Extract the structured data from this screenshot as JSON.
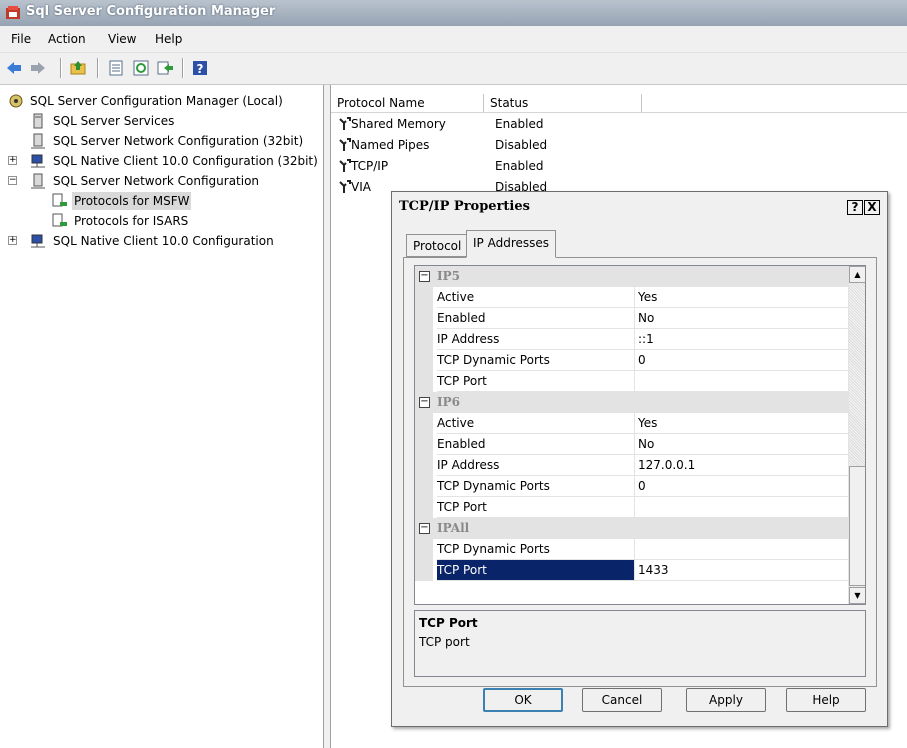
{
  "window": {
    "title": "Sql Server Configuration Manager"
  },
  "menu": [
    "File",
    "Action",
    "View",
    "Help"
  ],
  "toolbar": {
    "icons": [
      "back-arrow-icon",
      "forward-arrow-icon",
      "up-folder-icon",
      "properties-icon",
      "refresh-icon",
      "export-icon",
      "help-icon"
    ]
  },
  "tree": {
    "root": "SQL Server Configuration Manager (Local)",
    "items": [
      "SQL Server Services",
      "SQL Server Network Configuration (32bit)",
      "SQL Native Client 10.0 Configuration (32bit)",
      "SQL Server Network Configuration",
      "Protocols for MSFW",
      "Protocols for ISARS",
      "SQL Native Client 10.0 Configuration"
    ]
  },
  "list": {
    "headers": [
      "Protocol Name",
      "Status"
    ],
    "rows": [
      {
        "name": "Shared Memory",
        "status": "Enabled"
      },
      {
        "name": "Named Pipes",
        "status": "Disabled"
      },
      {
        "name": "TCP/IP",
        "status": "Enabled"
      },
      {
        "name": "VIA",
        "status": "Disabled"
      }
    ]
  },
  "dialog": {
    "title": "TCP/IP Properties",
    "help_btn": "?",
    "close_btn": "X",
    "tabs": [
      "Protocol",
      "IP Addresses"
    ],
    "sections": [
      {
        "name": "IP5",
        "expander": "−",
        "rows": [
          [
            "Active",
            "Yes"
          ],
          [
            "Enabled",
            "No"
          ],
          [
            "IP Address",
            "::1"
          ],
          [
            "TCP Dynamic Ports",
            "0"
          ],
          [
            "TCP Port",
            ""
          ]
        ]
      },
      {
        "name": "IP6",
        "expander": "−",
        "rows": [
          [
            "Active",
            "Yes"
          ],
          [
            "Enabled",
            "No"
          ],
          [
            "IP Address",
            "127.0.0.1"
          ],
          [
            "TCP Dynamic Ports",
            "0"
          ],
          [
            "TCP Port",
            ""
          ]
        ]
      },
      {
        "name": "IPAll",
        "expander": "−",
        "rows": [
          [
            "TCP Dynamic Ports",
            ""
          ],
          [
            "TCP Port",
            "1433"
          ]
        ]
      }
    ],
    "description": {
      "title": "TCP Port",
      "text": "TCP port"
    },
    "buttons": {
      "ok": "OK",
      "cancel": "Cancel",
      "apply": "Apply",
      "help": "Help"
    },
    "scroll": {
      "up": "▲",
      "down": "▼"
    }
  }
}
